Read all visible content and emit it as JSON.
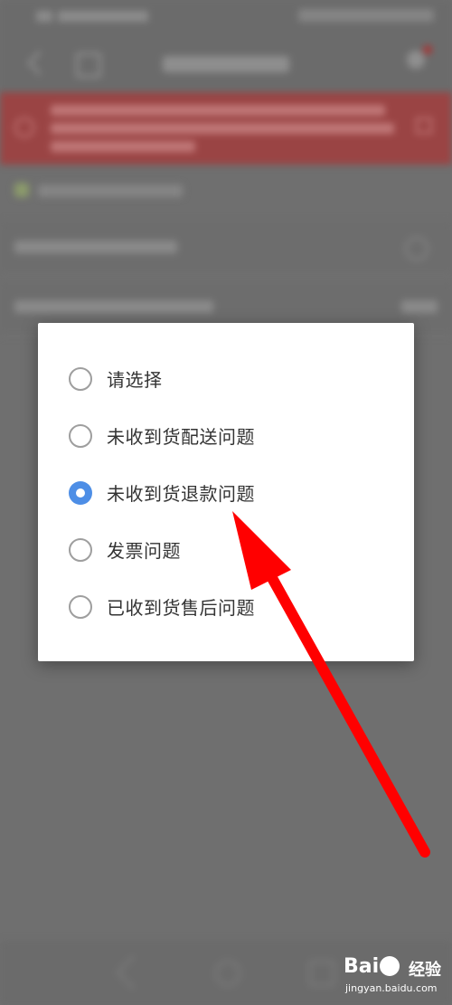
{
  "dialog": {
    "options": [
      {
        "label": "请选择",
        "selected": false
      },
      {
        "label": "未收到货配送问题",
        "selected": false
      },
      {
        "label": "未收到货退款问题",
        "selected": true
      },
      {
        "label": "发票问题",
        "selected": false
      },
      {
        "label": "已收到货售后问题",
        "selected": false
      }
    ]
  },
  "annotation": {
    "color": "#ff0000"
  },
  "watermark": {
    "logo": "Bai",
    "logo_suffix": "经验",
    "url": "jingyan.baidu.com"
  },
  "colors": {
    "accent": "#4d8ee6",
    "overlay": "#6f6f6f"
  }
}
